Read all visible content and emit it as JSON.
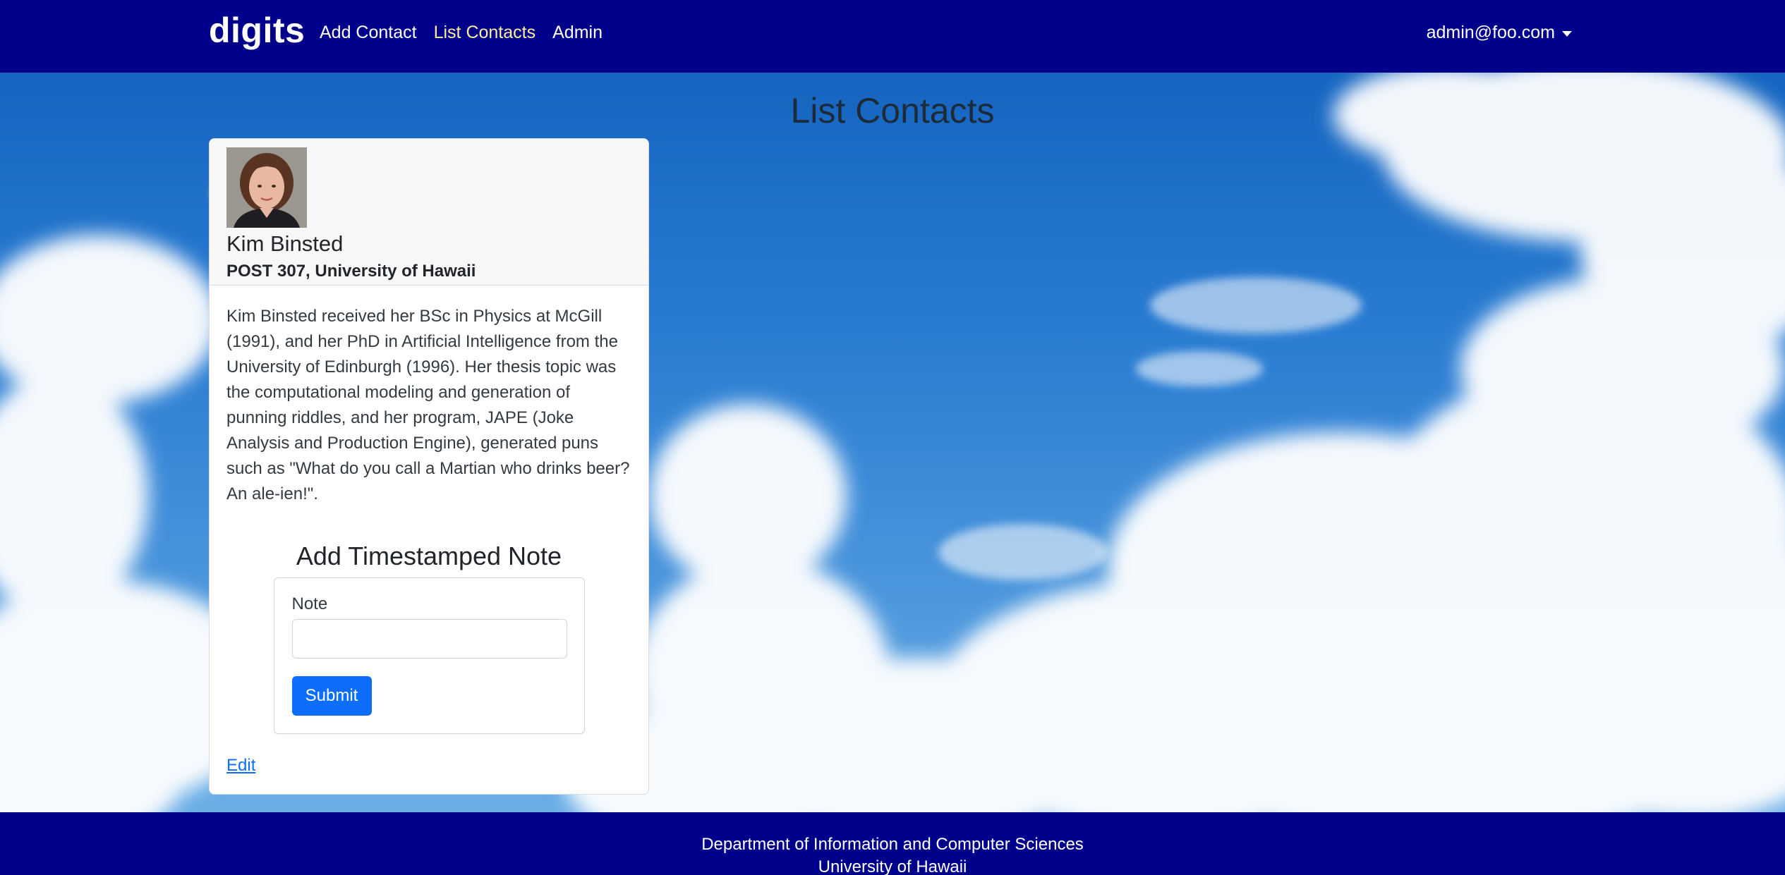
{
  "navbar": {
    "brand": "digits",
    "links": [
      {
        "label": "Add Contact",
        "active": false
      },
      {
        "label": "List Contacts",
        "active": true
      },
      {
        "label": "Admin",
        "active": false
      }
    ],
    "user": "admin@foo.com",
    "background": "#00008b",
    "active_link_color": "#ffeb99"
  },
  "page": {
    "title": "List Contacts"
  },
  "contact": {
    "name": "Kim Binsted",
    "address": "POST 307, University of Hawaii",
    "description": "Kim Binsted received her BSc in Physics at McGill (1991), and her PhD in Artificial Intelligence from the University of Edinburgh (1996). Her thesis topic was the computational modeling and generation of punning riddles, and her program, JAPE (Joke Analysis and Production Engine), generated puns such as \"What do you call a Martian who drinks beer? An ale-ien!\".",
    "note_form": {
      "title": "Add Timestamped Note",
      "label": "Note",
      "value": "",
      "submit_label": "Submit"
    },
    "edit_label": "Edit"
  },
  "footer": {
    "line1": "Department of Information and Computer Sciences",
    "line2": "University of Hawaii",
    "background": "#00008b"
  },
  "colors": {
    "primary_button": "#0d6efd",
    "link": "#0d6efd"
  }
}
